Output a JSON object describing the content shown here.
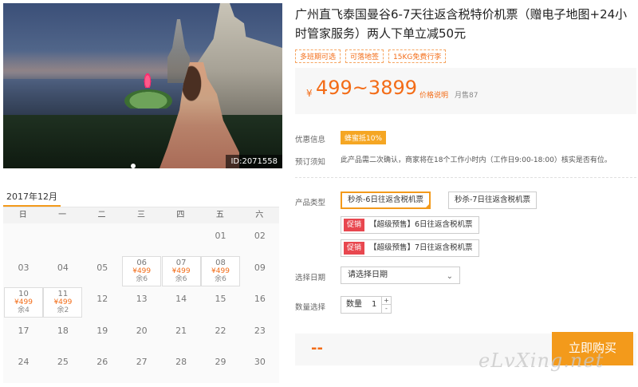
{
  "product": {
    "title": "广州直飞泰国曼谷6-7天往返含税特价机票（赠电子地图+24小时管家服务）两人下单立减50元",
    "tags": [
      "多班期可选",
      "可落地签",
      "15KG免费行李"
    ],
    "image_id": "ID:2071558"
  },
  "price": {
    "currency": "¥",
    "range": "499~3899",
    "explain": "价格说明",
    "sold": "月售87"
  },
  "info": {
    "promo_label": "优惠信息",
    "promo_badge": "蜂蜜抵10%",
    "notice_label": "预订须知",
    "notice_text": "此产品需二次确认，商家将在18个工作小时内（工作日9:00-18:00）核实是否有位。"
  },
  "options": {
    "label": "产品类型",
    "items": [
      {
        "sale": "",
        "text": "秒杀-6日往返含税机票",
        "selected": true
      },
      {
        "sale": "",
        "text": "秒杀-7日往返含税机票",
        "selected": false
      },
      {
        "sale": "促销",
        "text": "【超级预售】6日往返含税机票",
        "selected": false
      },
      {
        "sale": "促销",
        "text": "【超级预售】7日往返含税机票",
        "selected": false
      }
    ]
  },
  "date": {
    "label": "选择日期",
    "placeholder": "请选择日期"
  },
  "quantity": {
    "label": "数量选择",
    "prefix": "数量",
    "value": "1",
    "up": "+",
    "down": "-"
  },
  "buy": {
    "total": "--",
    "button": "立即购买"
  },
  "watermark": "eLvXing.net",
  "calendar": {
    "month": "2017年12月",
    "weekdays": [
      "日",
      "一",
      "二",
      "三",
      "四",
      "五",
      "六"
    ],
    "days": [
      {
        "day": "01",
        "col": 5,
        "row": 0
      },
      {
        "day": "02",
        "col": 6,
        "row": 0
      },
      {
        "day": "03",
        "col": 0,
        "row": 1
      },
      {
        "day": "04",
        "col": 1,
        "row": 1
      },
      {
        "day": "05",
        "col": 2,
        "row": 1
      },
      {
        "day": "06",
        "col": 3,
        "row": 1,
        "price": "¥499",
        "stock": "余6"
      },
      {
        "day": "07",
        "col": 4,
        "row": 1,
        "price": "¥499",
        "stock": "余6"
      },
      {
        "day": "08",
        "col": 5,
        "row": 1,
        "price": "¥499",
        "stock": "余6"
      },
      {
        "day": "09",
        "col": 6,
        "row": 1
      },
      {
        "day": "10",
        "col": 0,
        "row": 2,
        "price": "¥499",
        "stock": "余4"
      },
      {
        "day": "11",
        "col": 1,
        "row": 2,
        "price": "¥499",
        "stock": "余2"
      },
      {
        "day": "12",
        "col": 2,
        "row": 2
      },
      {
        "day": "13",
        "col": 3,
        "row": 2
      },
      {
        "day": "14",
        "col": 4,
        "row": 2
      },
      {
        "day": "15",
        "col": 5,
        "row": 2
      },
      {
        "day": "16",
        "col": 6,
        "row": 2
      },
      {
        "day": "17",
        "col": 0,
        "row": 3
      },
      {
        "day": "18",
        "col": 1,
        "row": 3
      },
      {
        "day": "19",
        "col": 2,
        "row": 3
      },
      {
        "day": "20",
        "col": 3,
        "row": 3
      },
      {
        "day": "21",
        "col": 4,
        "row": 3
      },
      {
        "day": "22",
        "col": 5,
        "row": 3
      },
      {
        "day": "23",
        "col": 6,
        "row": 3
      },
      {
        "day": "24",
        "col": 0,
        "row": 4
      },
      {
        "day": "25",
        "col": 1,
        "row": 4
      },
      {
        "day": "26",
        "col": 2,
        "row": 4
      },
      {
        "day": "27",
        "col": 3,
        "row": 4
      },
      {
        "day": "28",
        "col": 4,
        "row": 4
      },
      {
        "day": "29",
        "col": 5,
        "row": 4
      },
      {
        "day": "30",
        "col": 6,
        "row": 4
      }
    ]
  }
}
